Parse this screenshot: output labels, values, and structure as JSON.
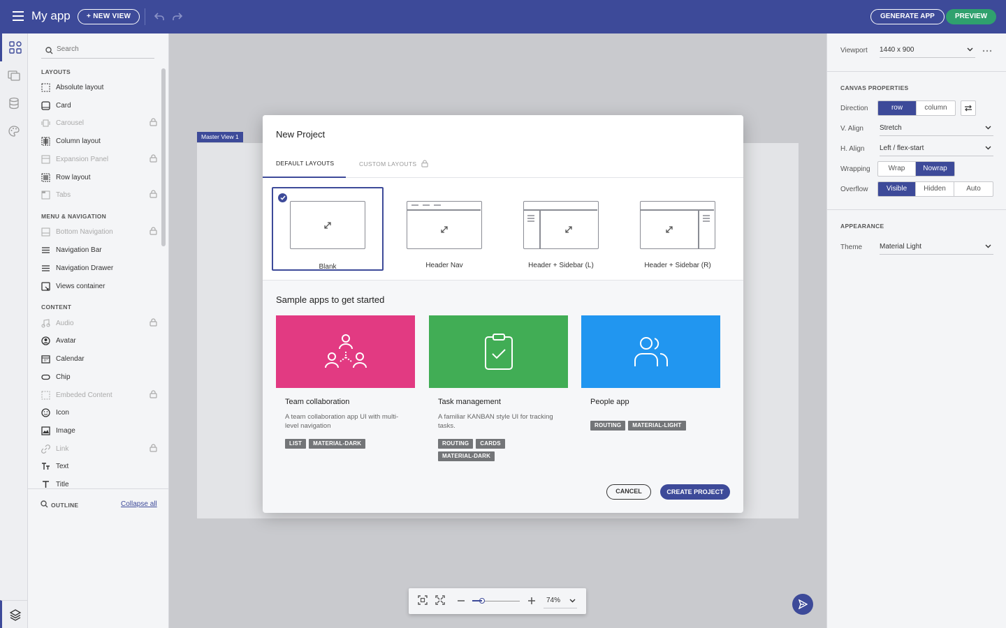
{
  "header": {
    "app_title": "My app",
    "new_view_label": "+ NEW VIEW",
    "generate_label": "GENERATE APP",
    "preview_label": "PREVIEW"
  },
  "sidebar": {
    "search_placeholder": "Search",
    "sections": [
      {
        "title": "LAYOUTS"
      },
      {
        "title": "MENU & NAVIGATION"
      },
      {
        "title": "CONTENT"
      }
    ],
    "items": [
      {
        "label": "Absolute layout",
        "icon": "absolute-layout-icon",
        "locked": false
      },
      {
        "label": "Card",
        "icon": "card-icon",
        "locked": false
      },
      {
        "label": "Carousel",
        "icon": "carousel-icon",
        "locked": true
      },
      {
        "label": "Column layout",
        "icon": "column-layout-icon",
        "locked": false
      },
      {
        "label": "Expansion Panel",
        "icon": "expansion-panel-icon",
        "locked": true
      },
      {
        "label": "Row layout",
        "icon": "row-layout-icon",
        "locked": false
      },
      {
        "label": "Tabs",
        "icon": "tabs-icon",
        "locked": true
      },
      {
        "label": "Bottom Navigation",
        "icon": "bottom-navigation-icon",
        "locked": true
      },
      {
        "label": "Navigation Bar",
        "icon": "navigation-bar-icon",
        "locked": false
      },
      {
        "label": "Navigation Drawer",
        "icon": "navigation-drawer-icon",
        "locked": false
      },
      {
        "label": "Views container",
        "icon": "views-container-icon",
        "locked": false
      },
      {
        "label": "Audio",
        "icon": "audio-icon",
        "locked": true
      },
      {
        "label": "Avatar",
        "icon": "avatar-icon",
        "locked": false
      },
      {
        "label": "Calendar",
        "icon": "calendar-icon",
        "locked": false
      },
      {
        "label": "Chip",
        "icon": "chip-icon",
        "locked": false
      },
      {
        "label": "Embeded Content",
        "icon": "embeded-content-icon",
        "locked": true
      },
      {
        "label": "Icon",
        "icon": "smiley-icon",
        "locked": false
      },
      {
        "label": "Image",
        "icon": "image-icon",
        "locked": false
      },
      {
        "label": "Link",
        "icon": "link-icon",
        "locked": true
      },
      {
        "label": "Text",
        "icon": "text-icon",
        "locked": false
      },
      {
        "label": "Title",
        "icon": "title-icon",
        "locked": false
      }
    ],
    "outline_label": "OUTLINE",
    "collapse_label": "Collapse all"
  },
  "canvas": {
    "master_view_label": "Master View 1"
  },
  "modal": {
    "title": "New Project",
    "tabs": [
      "DEFAULT LAYOUTS",
      "CUSTOM LAYOUTS"
    ],
    "layouts": [
      {
        "label": "Blank",
        "selected": true
      },
      {
        "label": "Header Nav",
        "selected": false
      },
      {
        "label": "Header + Sidebar (L)",
        "selected": false
      },
      {
        "label": "Header + Sidebar (R)",
        "selected": false
      }
    ],
    "samples_title": "Sample apps to get started",
    "samples": [
      {
        "name": "Team collaboration",
        "description": "A team collaboration app UI with multi-level navigation",
        "tags": [
          "LIST",
          "MATERIAL-DARK"
        ],
        "color": "#e23a82"
      },
      {
        "name": "Task management",
        "description": "A familiar KANBAN style UI for tracking tasks.",
        "tags": [
          "ROUTING",
          "CARDS",
          "MATERIAL-DARK"
        ],
        "color": "#41ad55"
      },
      {
        "name": "People app",
        "description": "",
        "tags": [
          "ROUTING",
          "MATERIAL-LIGHT"
        ],
        "color": "#2196f0"
      }
    ],
    "cancel_label": "CANCEL",
    "create_label": "CREATE PROJECT"
  },
  "properties": {
    "viewport_label": "Viewport",
    "viewport_value": "1440 x 900",
    "canvas_section": "CANVAS PROPERTIES",
    "direction_label": "Direction",
    "direction_options": [
      "row",
      "column"
    ],
    "direction_value": "row",
    "valign_label": "V. Align",
    "valign_value": "Stretch",
    "halign_label": "H. Align",
    "halign_value": "Left / flex-start",
    "wrapping_label": "Wrapping",
    "wrapping_options": [
      "Wrap",
      "Nowrap"
    ],
    "wrapping_value": "Nowrap",
    "overflow_label": "Overflow",
    "overflow_options": [
      "Visible",
      "Hidden",
      "Auto"
    ],
    "overflow_value": "Visible",
    "appearance_section": "APPEARANCE",
    "theme_label": "Theme",
    "theme_value": "Material Light"
  },
  "zoom": {
    "value": "74%",
    "level": 0.2
  },
  "colors": {
    "primary": "#3d4a99",
    "preview": "#2fa16e"
  }
}
